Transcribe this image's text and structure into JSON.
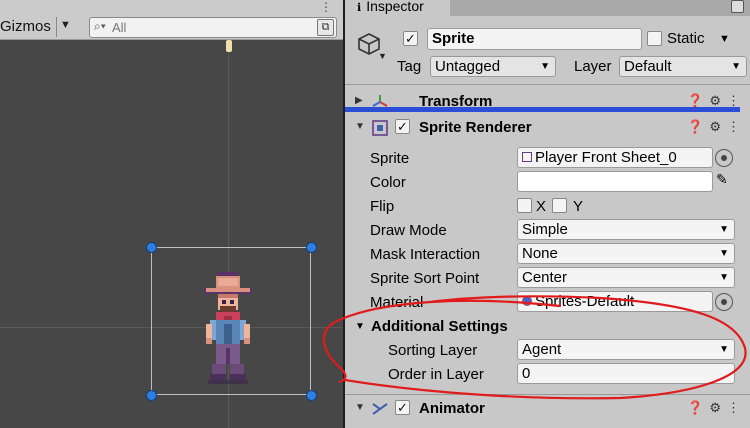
{
  "scene": {
    "gizmos_label": "Gizmos",
    "search_placeholder": "All",
    "icons": [
      "search-icon",
      "dropdown-arrow-icon",
      "scene-menu-icon"
    ]
  },
  "inspector": {
    "tab_label": "Inspector",
    "object": {
      "active": true,
      "name": "Sprite",
      "static_label": "Static",
      "tag_label": "Tag",
      "tag_value": "Untagged",
      "layer_label": "Layer",
      "layer_value": "Default"
    },
    "transform": {
      "title": "Transform"
    },
    "sprite_renderer": {
      "title": "Sprite Renderer",
      "enabled": true,
      "props": {
        "sprite_label": "Sprite",
        "sprite_value": "Player Front Sheet_0",
        "color_label": "Color",
        "color_value": "#ffffff",
        "flip_label": "Flip",
        "flip_x": "X",
        "flip_y": "Y",
        "draw_mode_label": "Draw Mode",
        "draw_mode_value": "Simple",
        "mask_label": "Mask Interaction",
        "mask_value": "None",
        "sort_point_label": "Sprite Sort Point",
        "sort_point_value": "Center",
        "material_label": "Material",
        "material_value": "Sprites-Default"
      },
      "additional_settings": {
        "title": "Additional Settings",
        "sorting_layer_label": "Sorting Layer",
        "sorting_layer_value": "Agent",
        "order_label": "Order in Layer",
        "order_value": "0"
      }
    },
    "animator": {
      "title": "Animator",
      "enabled": true
    }
  },
  "colors": {
    "scene_bg": "#474747",
    "inspector_bg": "#c8c8c8",
    "handle_blue": "#2f7fe0",
    "annotation_red": "#e01b1b",
    "highlight_blue": "#2a4fd6"
  }
}
